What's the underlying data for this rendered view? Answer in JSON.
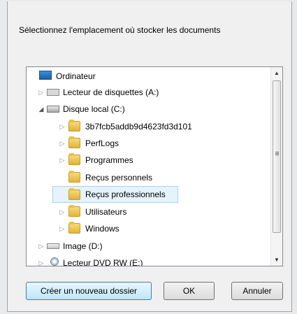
{
  "prompt": "Sélectionnez l'emplacement où stocker les documents",
  "tree": {
    "items": [
      {
        "label": "Ordinateur"
      },
      {
        "label": "Lecteur de disquettes (A:)"
      },
      {
        "label": "Disque local (C:)"
      },
      {
        "label": "3b7fcb5addb9d4623fd3d101"
      },
      {
        "label": "PerfLogs"
      },
      {
        "label": "Programmes"
      },
      {
        "label": "Reçus personnels"
      },
      {
        "label": "Reçus professionnels"
      },
      {
        "label": "Utilisateurs"
      },
      {
        "label": "Windows"
      },
      {
        "label": "Image (D:)"
      },
      {
        "label": "Lecteur DVD RW (E:)"
      }
    ]
  },
  "buttons": {
    "new_folder": "Créer un nouveau dossier",
    "ok": "OK",
    "cancel": "Annuler"
  }
}
